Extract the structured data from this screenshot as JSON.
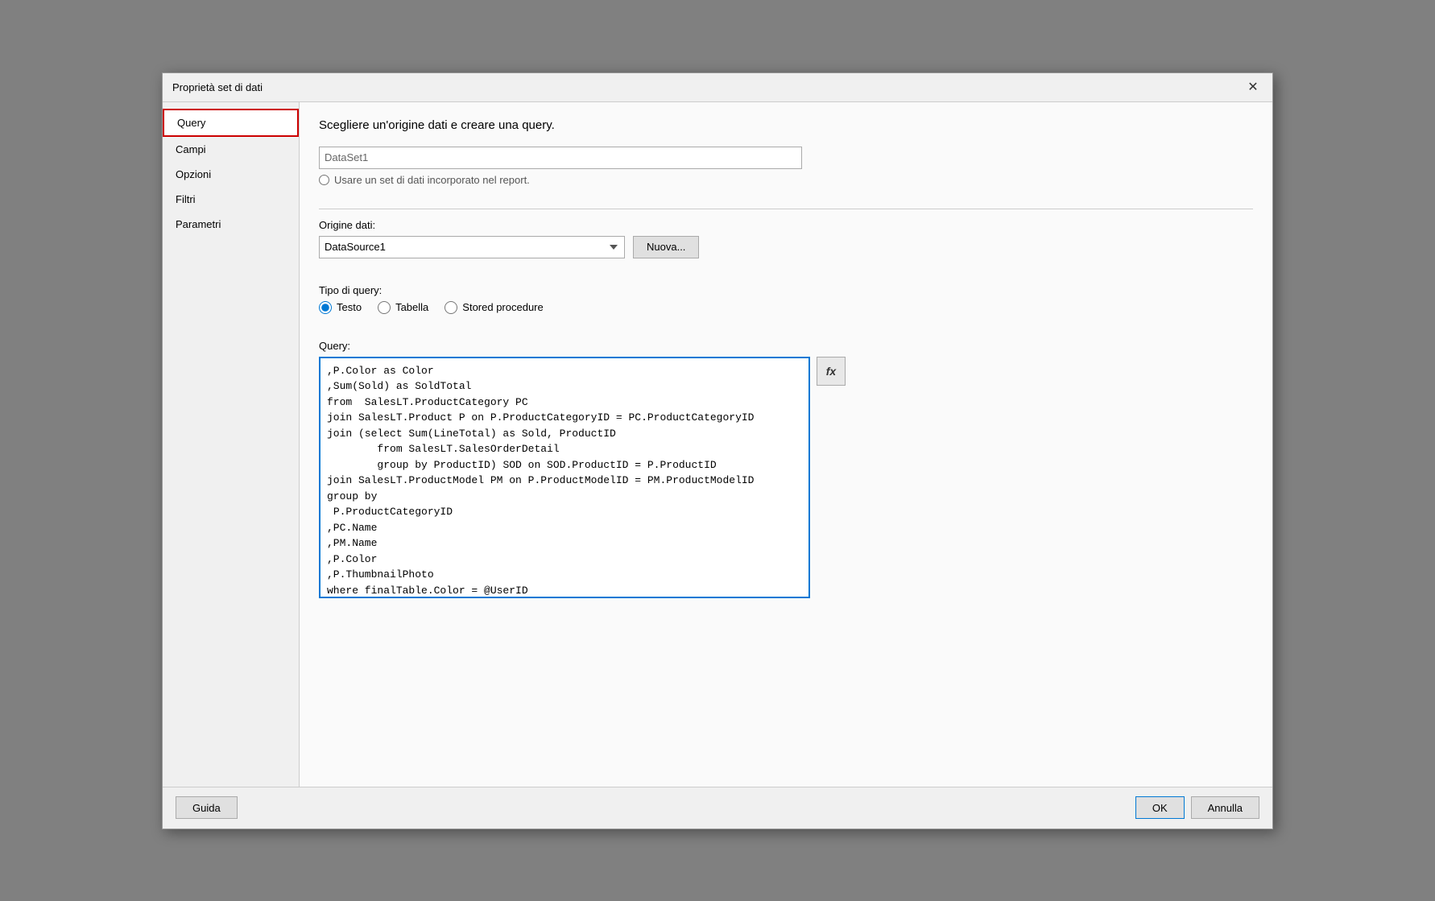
{
  "dialog": {
    "title": "Proprietà set di dati",
    "close_label": "✕"
  },
  "sidebar": {
    "items": [
      {
        "id": "query",
        "label": "Query",
        "active": true
      },
      {
        "id": "campi",
        "label": "Campi",
        "active": false
      },
      {
        "id": "opzioni",
        "label": "Opzioni",
        "active": false
      },
      {
        "id": "filtri",
        "label": "Filtri",
        "active": false
      },
      {
        "id": "parametri",
        "label": "Parametri",
        "active": false
      }
    ]
  },
  "main": {
    "section_title": "Scegliere un'origine dati e creare una query.",
    "dataset_value": "DataSet1",
    "embedded_radio_label": "Usare un set di dati incorporato nel report.",
    "datasource_label": "Origine dati:",
    "datasource_value": "DataSource1",
    "nuova_label": "Nuova...",
    "query_type_label": "Tipo di query:",
    "query_types": [
      {
        "id": "testo",
        "label": "Testo",
        "checked": true
      },
      {
        "id": "tabella",
        "label": "Tabella",
        "checked": false
      },
      {
        "id": "stored",
        "label": "Stored procedure",
        "checked": false
      }
    ],
    "query_label": "Query:",
    "query_lines": [
      ",P.Color as Color",
      ",Sum(Sold) as SoldTotal",
      "from  SalesLT.ProductCategory PC",
      "join SalesLT.Product P on P.ProductCategoryID = PC.ProductCategoryID",
      "join (select Sum(LineTotal) as Sold, ProductID",
      "        from SalesLT.SalesOrderDetail",
      "        group by ProductID) SOD on SOD.ProductID = P.ProductID",
      "join SalesLT.ProductModel PM on P.ProductModelID = PM.ProductModelID",
      "group by",
      " P.ProductCategoryID",
      ",PC.Name",
      ",PM.Name",
      ",P.Color",
      ",P.ThumbnailPhoto"
    ],
    "query_last_line": "where finalTable.Color = @UserID",
    "fx_label": "fx"
  },
  "footer": {
    "guida_label": "Guida",
    "ok_label": "OK",
    "annulla_label": "Annulla"
  }
}
